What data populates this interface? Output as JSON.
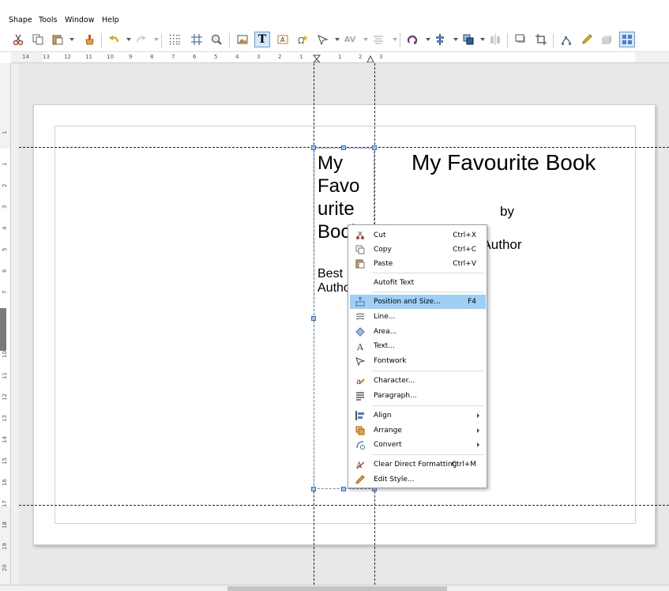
{
  "menubar": {
    "items": [
      {
        "label": "Shape"
      },
      {
        "label": "Tools"
      },
      {
        "label": "Window"
      },
      {
        "label": "Help"
      }
    ]
  },
  "toolbar": {
    "icons": [
      "cut-icon",
      "copy-icon",
      "paste-icon",
      "clone-formatting-icon",
      "undo-icon",
      "redo-icon",
      "grid-icon",
      "snap-grid-icon",
      "zoom-icon",
      "image-icon",
      "text-box-icon",
      "fontwork-icon",
      "special-character-icon",
      "curve-icon",
      "spacing-icon",
      "align-icon",
      "rotate-icon",
      "align-objects-icon",
      "arrange-icon",
      "distribute-icon",
      "shadow-icon",
      "crop-icon",
      "points-icon",
      "draw-icon",
      "3d-icon",
      "toggle-extrusion-icon"
    ]
  },
  "ruler": {
    "h_labels": [
      "14",
      "13",
      "12",
      "11",
      "10",
      "9",
      "8",
      "7",
      "6",
      "5",
      "4",
      "3",
      "2",
      "1",
      "1",
      "2",
      "3"
    ],
    "v_labels": [
      "1",
      "1",
      "2",
      "3",
      "4",
      "5",
      "6",
      "7",
      "8",
      "9",
      "10",
      "11",
      "12",
      "13",
      "14",
      "15",
      "16",
      "17",
      "18",
      "19",
      "20"
    ]
  },
  "document": {
    "textbox_title": "My Favo urite Book",
    "textbox_author": "Best Autho",
    "title": "My Favourite Book",
    "by": "by",
    "author": "est Author"
  },
  "context_menu": {
    "items": [
      {
        "label": "Cut",
        "shortcut": "Ctrl+X",
        "icon": "scissors-icon"
      },
      {
        "label": "Copy",
        "shortcut": "Ctrl+C",
        "icon": "copy-icon"
      },
      {
        "label": "Paste",
        "shortcut": "Ctrl+V",
        "icon": "paste-icon"
      },
      {
        "label": "Autofit Text",
        "shortcut": "",
        "icon": ""
      },
      {
        "label": "Position and Size...",
        "shortcut": "F4",
        "icon": "position-size-icon"
      },
      {
        "label": "Line...",
        "shortcut": "",
        "icon": "line-icon"
      },
      {
        "label": "Area...",
        "shortcut": "",
        "icon": "area-icon"
      },
      {
        "label": "Text...",
        "shortcut": "",
        "icon": "text-icon"
      },
      {
        "label": "Fontwork",
        "shortcut": "",
        "icon": "fontwork-icon"
      },
      {
        "label": "Character...",
        "shortcut": "",
        "icon": "character-icon"
      },
      {
        "label": "Paragraph...",
        "shortcut": "",
        "icon": "paragraph-icon"
      },
      {
        "label": "Align",
        "shortcut": "",
        "icon": "align-icon"
      },
      {
        "label": "Arrange",
        "shortcut": "",
        "icon": "arrange-icon"
      },
      {
        "label": "Convert",
        "shortcut": "",
        "icon": "convert-icon"
      },
      {
        "label": "Clear Direct Formatting",
        "shortcut": "Ctrl+M",
        "icon": "clear-formatting-icon"
      },
      {
        "label": "Edit Style...",
        "shortcut": "",
        "icon": "edit-style-icon"
      }
    ]
  }
}
